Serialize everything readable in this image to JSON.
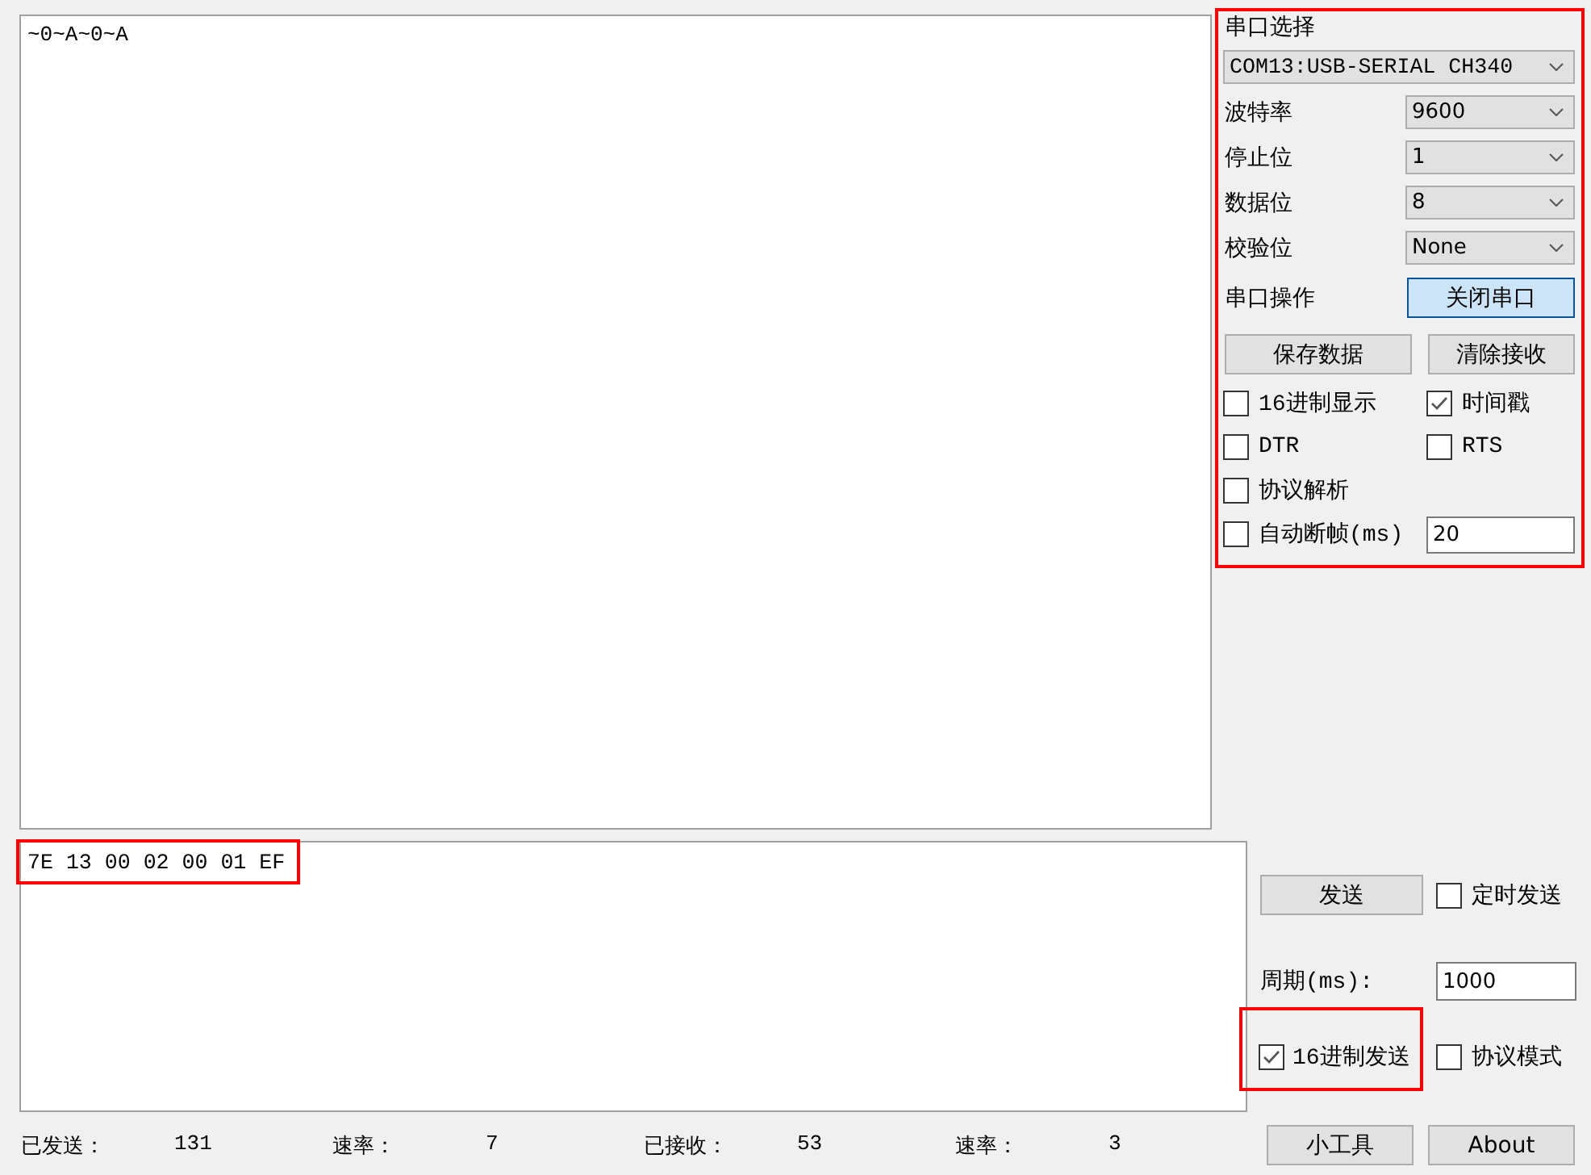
{
  "receive_area": {
    "text": "~0~A~0~A"
  },
  "port_panel": {
    "highlighted": true,
    "title": "串口选择",
    "port": "COM13:USB-SERIAL CH340",
    "settings": [
      {
        "label": "波特率",
        "value": "9600"
      },
      {
        "label": "停止位",
        "value": "1"
      },
      {
        "label": "数据位",
        "value": "8"
      },
      {
        "label": "校验位",
        "value": "None"
      }
    ],
    "operation": {
      "label": "串口操作",
      "button": "关闭串口",
      "focused": true
    },
    "buttons": [
      "保存数据",
      "清除接收"
    ],
    "option_rows": [
      {
        "options": [
          {
            "label": "16进制显示",
            "checked": false
          },
          {
            "label": "时间戳",
            "checked": true
          }
        ]
      },
      {
        "options": [
          {
            "label": "DTR",
            "checked": false
          },
          {
            "label": "RTS",
            "checked": false
          }
        ]
      },
      {
        "options": [
          {
            "label": "协议解析",
            "checked": false
          }
        ]
      },
      {
        "options": [
          {
            "label": "自动断帧(ms)",
            "checked": false,
            "field_value": "20"
          }
        ]
      }
    ]
  },
  "send_area": {
    "text": "7E 13 00 02 00 01 EF",
    "highlighted": true
  },
  "send_controls": {
    "send_button": "发送",
    "timed_send": {
      "label": "定时发送",
      "checked": false
    },
    "period": {
      "label": "周期(ms):",
      "value": "1000"
    },
    "hex_send": {
      "label": "16进制发送",
      "checked": true,
      "highlighted": true
    },
    "protocol_mode": {
      "label": "协议模式",
      "checked": false
    }
  },
  "status_bar": [
    {
      "label": "已发送：",
      "value": "131"
    },
    {
      "label": "速率：",
      "value": "7"
    },
    {
      "label": "已接收：",
      "value": "53"
    },
    {
      "label": "速率：",
      "value": "3"
    }
  ],
  "footer_buttons": [
    "小工具",
    "About"
  ]
}
